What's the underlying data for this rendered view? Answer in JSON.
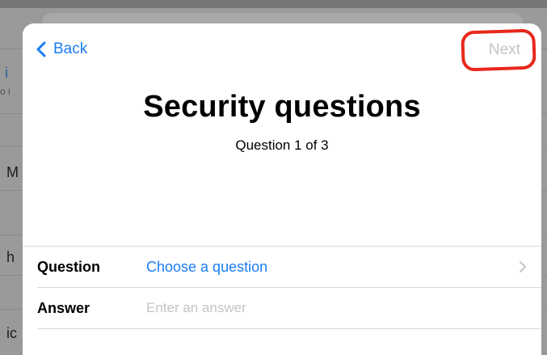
{
  "background": {
    "rows": [
      {
        "text": "i"
      },
      {
        "text": "o i",
        "sub": true
      },
      {
        "text": "M"
      },
      {
        "text": "h"
      },
      {
        "text": "ic"
      }
    ]
  },
  "nav": {
    "back_label": "Back",
    "next_label": "Next",
    "next_enabled": false
  },
  "header": {
    "title": "Security questions",
    "subtitle": "Question 1 of 3"
  },
  "form": {
    "question_label": "Question",
    "question_value": "Choose a question",
    "answer_label": "Answer",
    "answer_placeholder": "Enter an answer",
    "answer_value": ""
  },
  "colors": {
    "accent": "#1a7cf5",
    "disabled": "#c3c3c5",
    "annotation": "#e8281c"
  },
  "icons": {
    "back": "chevron-left-icon",
    "disclosure": "chevron-right-icon"
  }
}
